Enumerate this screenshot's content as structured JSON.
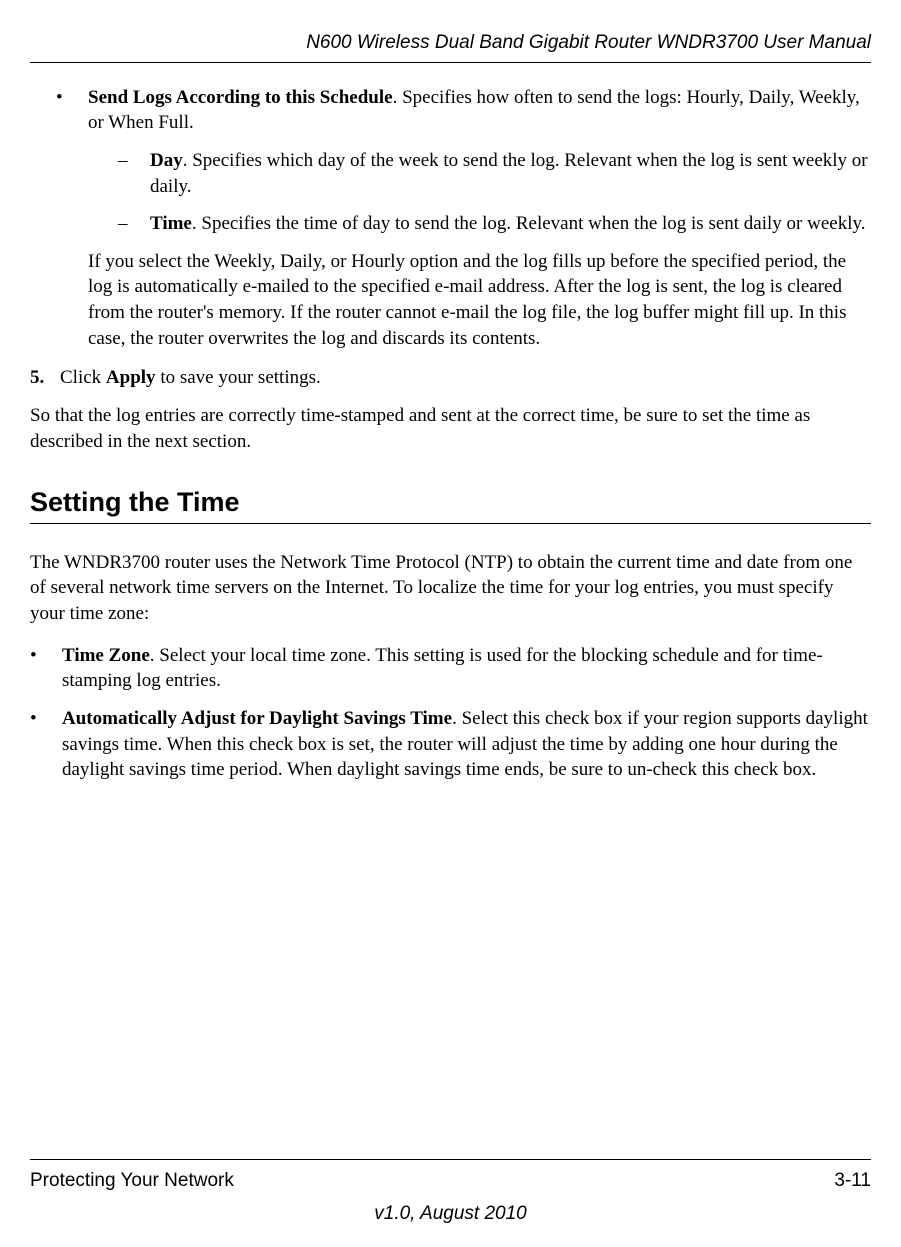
{
  "header": {
    "title": "N600 Wireless Dual Band Gigabit Router WNDR3700 User Manual"
  },
  "content": {
    "sendLogs": {
      "label": "Send Logs According to this Schedule",
      "desc": ". Specifies how often to send the logs: Hourly, Daily, Weekly, or When Full.",
      "day": {
        "label": "Day",
        "desc": ". Specifies which day of the week to send the log. Relevant when the log is sent weekly or daily."
      },
      "time": {
        "label": "Time",
        "desc": ". Specifies the time of day to send the log. Relevant when the log is sent daily or weekly."
      },
      "afterPara": "If you select the Weekly, Daily, or Hourly option and the log fills up before the specified period, the log is automatically e-mailed to the specified e-mail address. After the log is sent, the log is cleared from the router's memory. If the router cannot e-mail the log file, the log buffer might fill up. In this case, the router overwrites the log and discards its contents."
    },
    "step5": {
      "num": "5.",
      "pre": "Click ",
      "bold": "Apply",
      "post": " to save your settings."
    },
    "closingPara": "So that the log entries are correctly time-stamped and sent at the correct time, be sure to set the time as described in the next section.",
    "sectionHeading": "Setting the Time",
    "timeIntro": "The WNDR3700 router uses the Network Time Protocol (NTP) to obtain the current time and date from one of several network time servers on the Internet. To localize the time for your log entries, you must specify your time zone:",
    "timezone": {
      "label": "Time Zone",
      "desc": ". Select your local time zone. This setting is used for the blocking schedule and for time-stamping log entries."
    },
    "dst": {
      "label": "Automatically Adjust for Daylight Savings Time",
      "desc": ". Select this check box if your region supports daylight savings time. When this check box is set, the router will adjust the time by adding one hour during the daylight savings time period. When daylight savings time ends, be sure to un-check this check box."
    }
  },
  "footer": {
    "chapter": "Protecting Your Network",
    "pageNum": "3-11",
    "version": "v1.0, August 2010"
  },
  "markers": {
    "bullet": "•",
    "dash": "–"
  }
}
